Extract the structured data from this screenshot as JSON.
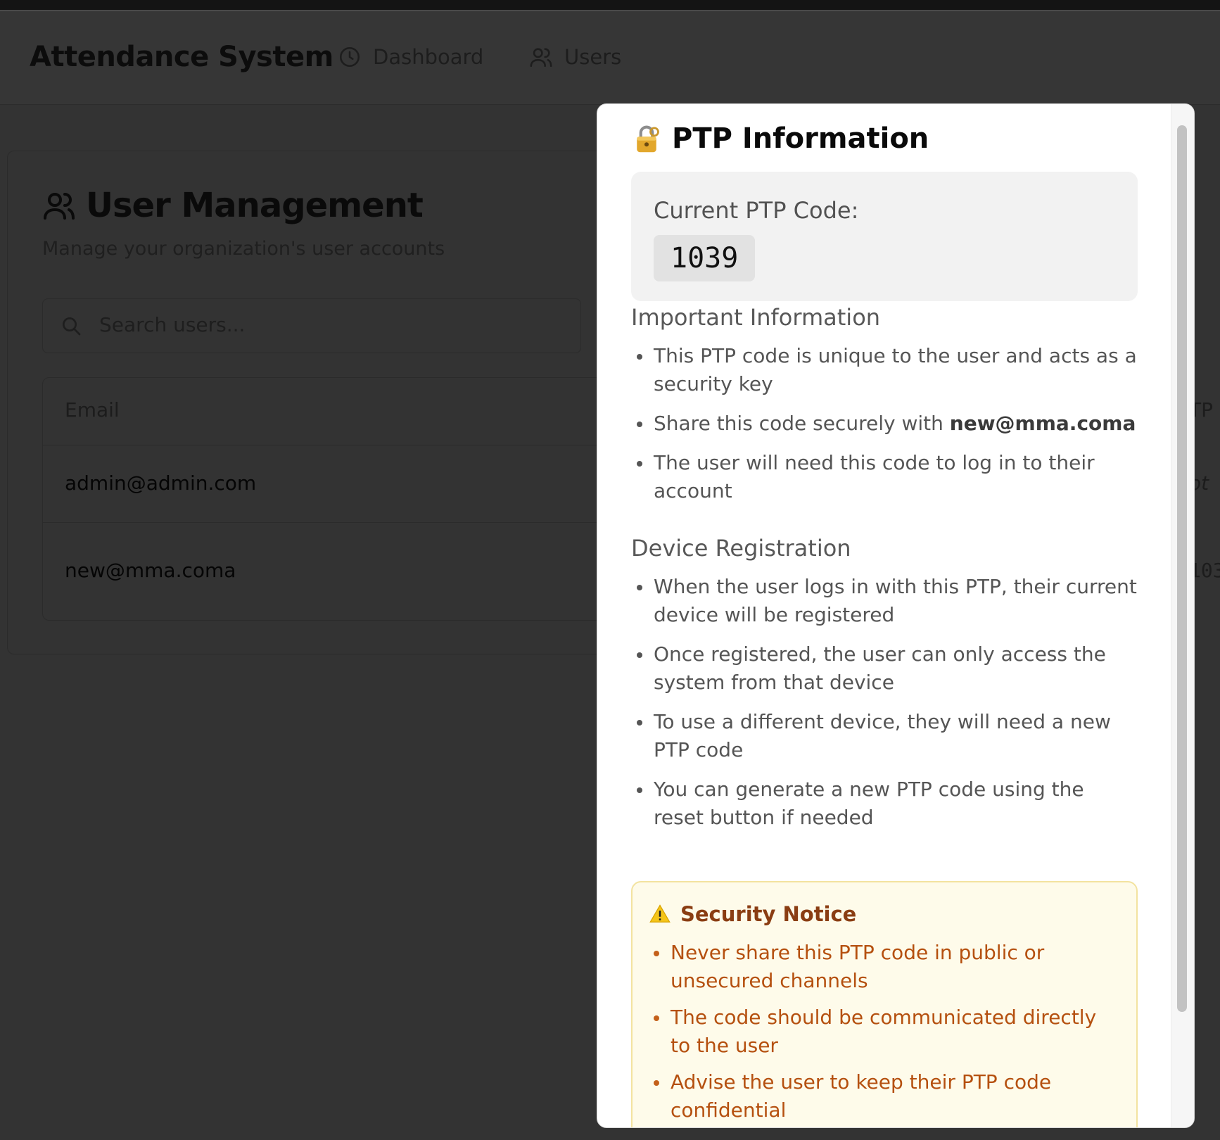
{
  "header": {
    "brand": "Attendance System",
    "nav": [
      {
        "label": "Dashboard",
        "icon": "clock-icon"
      },
      {
        "label": "Users",
        "icon": "users-icon"
      }
    ]
  },
  "page": {
    "title": "User Management",
    "subtitle": "Manage your organization's user accounts",
    "search_placeholder": "Search users...",
    "table": {
      "columns": [
        "Email"
      ],
      "rows": [
        {
          "email": "admin@admin.com"
        },
        {
          "email": "new@mma.coma"
        }
      ],
      "peek_texts": [
        "TP",
        "ot",
        "103"
      ]
    }
  },
  "modal": {
    "title": "PTP Information",
    "code_label": "Current PTP Code:",
    "code": "1039",
    "important": {
      "heading": "Important Information",
      "items": [
        "This PTP code is unique to the user and acts as a security key",
        "Share this code securely with",
        "The user will need this code to log in to their account"
      ],
      "share_email": "new@mma.coma"
    },
    "device": {
      "heading": "Device Registration",
      "items": [
        "When the user logs in with this PTP, their current device will be registered",
        "Once registered, the user can only access the system from that device",
        "To use a different device, they will need a new PTP code",
        "You can generate a new PTP code using the reset button if needed"
      ]
    },
    "notice": {
      "heading": "Security Notice",
      "items": [
        "Never share this PTP code in public or unsecured channels",
        "The code should be communicated directly to the user",
        "Advise the user to keep their PTP code confidential"
      ],
      "accent": "#b5500f"
    }
  }
}
